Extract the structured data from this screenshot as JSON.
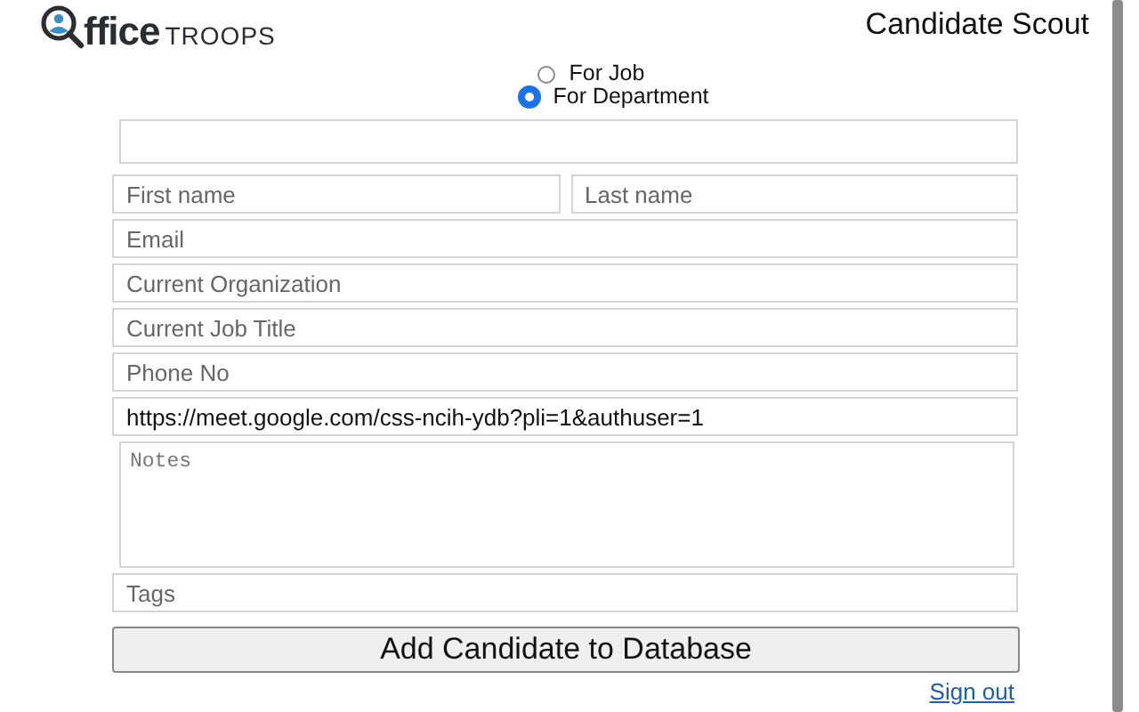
{
  "logo": {
    "word": "ffice",
    "brand": "TROOPS"
  },
  "title": "Candidate Scout",
  "target_options": [
    {
      "label": "For Job",
      "selected": false
    },
    {
      "label": "For Department",
      "selected": true
    }
  ],
  "name_fields": [
    {
      "placeholder": "First name"
    },
    {
      "placeholder": "Last name"
    }
  ],
  "fields": [
    {
      "kind": "input",
      "placeholder": "Email"
    },
    {
      "kind": "input",
      "placeholder": "Current Organization"
    },
    {
      "kind": "input",
      "placeholder": "Current Job Title"
    },
    {
      "kind": "input",
      "placeholder": "Phone No"
    },
    {
      "kind": "input",
      "value": "https://meet.google.com/css-ncih-ydb?pli=1&authuser=1"
    },
    {
      "kind": "textarea",
      "placeholder": "Notes"
    },
    {
      "kind": "input",
      "placeholder": "Tags"
    }
  ],
  "submit": "Add Candidate to Database",
  "sign_out": "Sign out"
}
